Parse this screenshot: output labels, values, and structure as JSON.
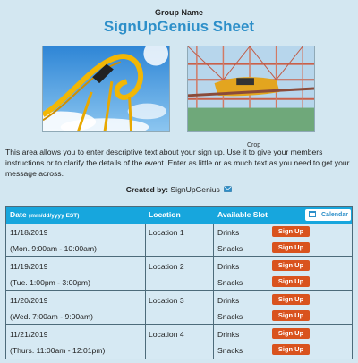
{
  "header": {
    "group_name": "Group Name",
    "sheet_title": "SignUpGenius Sheet"
  },
  "crop_label": "Crop",
  "description": "This area allows you to enter descriptive text about your sign up. Use it to give your members instructions or to clarify the details of the event. Enter as little or as much text as you need to get your message across.",
  "created_by": {
    "label": "Created by:",
    "name": "SignUpGenius",
    "icon": "mail-icon"
  },
  "table": {
    "col_date": "Date",
    "col_date_hint": "(mm/dd/yyyy EST)",
    "col_location": "Location",
    "col_slot": "Available Slot",
    "calendar_label": "Calendar",
    "rows": [
      {
        "date": "11/18/2019",
        "time": "(Mon. 9:00am - 10:00am)",
        "location": "Location 1",
        "slots": [
          "Drinks",
          "Snacks"
        ]
      },
      {
        "date": "11/19/2019",
        "time": "(Tue. 1:00pm - 3:00pm)",
        "location": "Location 2",
        "slots": [
          "Drinks",
          "Snacks"
        ]
      },
      {
        "date": "11/20/2019",
        "time": "(Wed. 7:00am - 9:00am)",
        "location": "Location 3",
        "slots": [
          "Drinks",
          "Snacks"
        ]
      },
      {
        "date": "11/21/2019",
        "time": "(Thurs. 11:00am - 12:01pm)",
        "location": "Location 4",
        "slots": [
          "Drinks",
          "Snacks"
        ]
      }
    ],
    "signup_label": "Sign Up"
  },
  "colors": {
    "background": "#d3e7f1",
    "title": "#2d8fc9",
    "header_bar": "#17a6dd",
    "signup_button": "#d9531e"
  }
}
